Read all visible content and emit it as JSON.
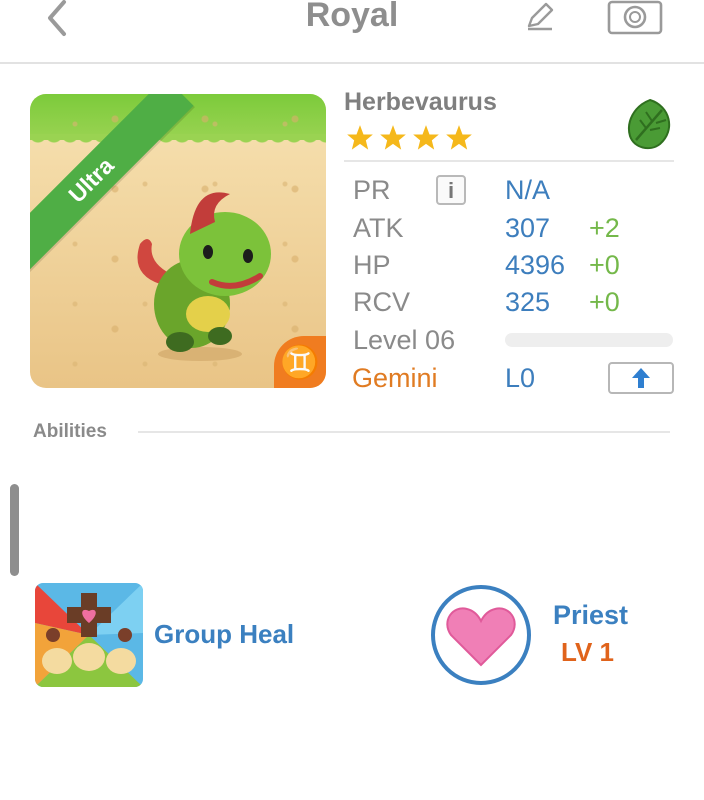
{
  "header": {
    "title": "Royal"
  },
  "creature": {
    "name": "Herbevaurus",
    "rarity": "Ultra",
    "stars": 4,
    "element_icon": "leaf-icon",
    "zodiac_icon": "gemini-icon"
  },
  "stats": [
    {
      "label": "PR",
      "value": "N/A",
      "bonus": ""
    },
    {
      "label": "ATK",
      "value": "307",
      "bonus": "+2"
    },
    {
      "label": "HP",
      "value": "4396",
      "bonus": "+0"
    },
    {
      "label": "RCV",
      "value": "325",
      "bonus": "+0"
    }
  ],
  "level": {
    "label": "Level 06",
    "progress": 0
  },
  "sign": {
    "name": "Gemini",
    "level": "L0"
  },
  "abilities": {
    "section_label": "Abilities",
    "skill_name": "Group Heal",
    "role_name": "Priest",
    "role_level": "LV 1"
  },
  "colors": {
    "accent_blue": "#3b80c0",
    "bonus_green": "#74b84a",
    "gemini_orange": "#e07b22",
    "rarity_green": "#4fae45"
  }
}
